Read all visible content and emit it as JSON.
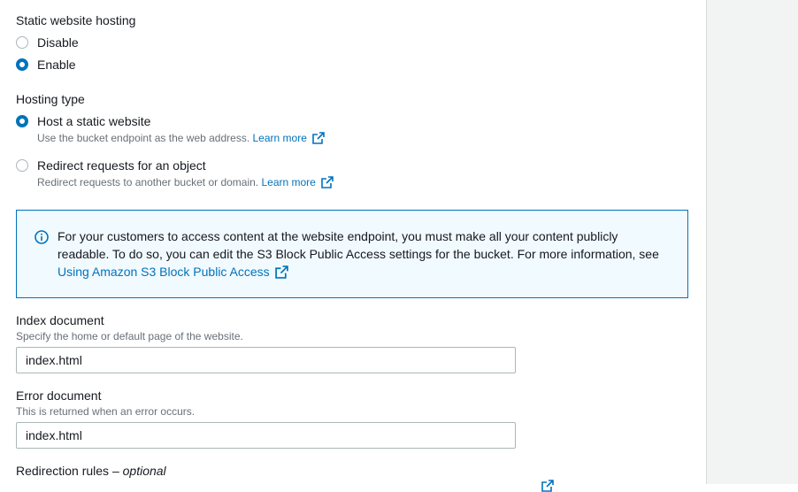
{
  "static_hosting": {
    "title": "Static website hosting",
    "options": [
      "Disable",
      "Enable"
    ],
    "selected": "Enable"
  },
  "hosting_type": {
    "title": "Hosting type",
    "host": {
      "label": "Host a static website",
      "desc": "Use the bucket endpoint as the web address.",
      "link": "Learn more"
    },
    "redirect": {
      "label": "Redirect requests for an object",
      "desc": "Redirect requests to another bucket or domain.",
      "link": "Learn more"
    },
    "selected": "Host a static website"
  },
  "info": {
    "line1": "For your customers to access content at the website endpoint, you must make all your content publicly",
    "line2": "readable. To do so, you can edit the S3 Block Public Access settings for the bucket. For more information, see",
    "link": "Using Amazon S3 Block Public Access"
  },
  "index_document": {
    "label": "Index document",
    "desc": "Specify the home or default page of the website.",
    "value": "index.html"
  },
  "error_document": {
    "label": "Error document",
    "desc": "This is returned when an error occurs.",
    "value": "index.html"
  },
  "redirection_rules": {
    "label": "Redirection rules – ",
    "optional": "optional"
  },
  "colors": {
    "accent": "#0073bb",
    "info_bg": "#f1faff",
    "side_panel": "#f2f3f3"
  }
}
